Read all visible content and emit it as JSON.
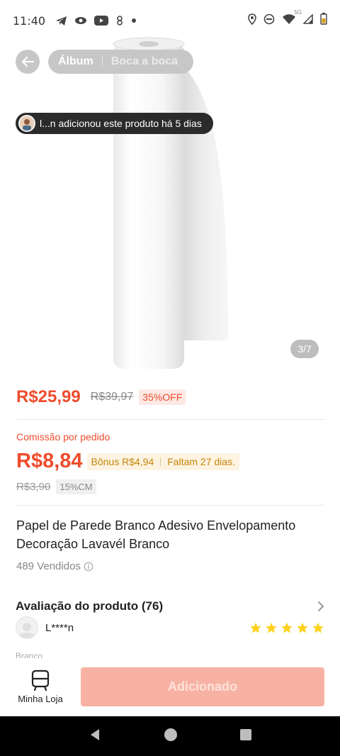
{
  "status_bar": {
    "time": "11:40",
    "left_icons": [
      "telegram-icon",
      "eye-icon",
      "youtube-icon",
      "app-icon",
      "dot-icon"
    ],
    "right_icons": [
      "location-icon",
      "dnd-icon",
      "wifi-icon",
      "signal-icon",
      "battery-icon"
    ],
    "wifi_label": "5G"
  },
  "header": {
    "tabs": [
      {
        "label": "Álbum",
        "active": true
      },
      {
        "label": "Boca a boca",
        "active": false
      }
    ]
  },
  "notification": {
    "text": "l...n adicionou este produto há 5 dias"
  },
  "gallery": {
    "page_indicator": "3/7",
    "current": 3,
    "total": 7
  },
  "price": {
    "current": "R$25,99",
    "original": "R$39,97",
    "discount": "35%OFF"
  },
  "commission": {
    "label": "Comissão por pedido",
    "value": "R$8,84",
    "bonus": "Bônus R$4,94",
    "remaining": "Faltam 27 dias.",
    "old_value": "R$3,90",
    "rate": "15%CM"
  },
  "product": {
    "title": "Papel de Parede Branco Adesivo Envelopamento Decoração Lavavél Branco",
    "sold": "489 Vendidos"
  },
  "reviews": {
    "title": "Avaliação do produto (76)",
    "first": {
      "user": "L****n",
      "rating": 5,
      "variant": "Branco"
    }
  },
  "action_bar": {
    "store_label": "Minha Loja",
    "add_label": "Adicionado"
  },
  "colors": {
    "accent": "#ee4d2d",
    "button_disabled": "#f7b2a3",
    "star": "#ffd21f"
  }
}
